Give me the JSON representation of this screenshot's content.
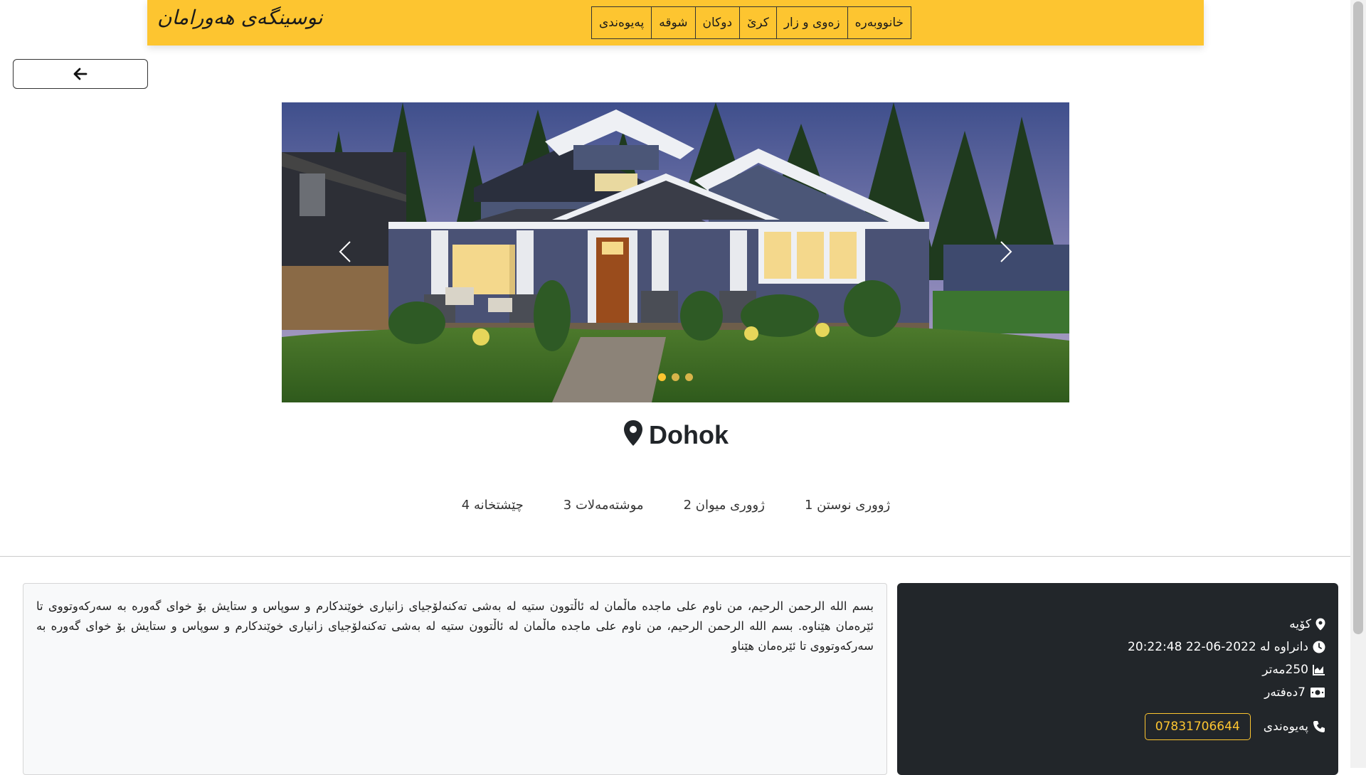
{
  "brand": {
    "name": "نوسینگەی هەورامان"
  },
  "nav": {
    "items": [
      {
        "label": "خانووبەرە"
      },
      {
        "label": "زەوی و زار"
      },
      {
        "label": "کرێ"
      },
      {
        "label": "دوکان"
      },
      {
        "label": "شوقە"
      },
      {
        "label": "پەیوەندی"
      }
    ]
  },
  "back_button": {
    "icon": "arrow-left-icon"
  },
  "carousel": {
    "slide_count": 3,
    "active_index": 0
  },
  "property": {
    "location_title": "Dohok",
    "features": [
      {
        "label": "ژووری نوستن 1"
      },
      {
        "label": "ژووری میوان 2"
      },
      {
        "label": "موشتەمەلات 3"
      },
      {
        "label": "چێشتخانە 4"
      }
    ],
    "description": "بسم الله الرحمن الرحيم، من ناوم على ماجده ماڵمان لە ئاڵتوون ستیە لە بەشی تەکنەلۆجیای زانیاری خوێندکارم و سوپاس و ستایش بۆ خوای گەورە بە سەرکەوتووی تا ئێرەمان هێناوە. بسم الله الرحمن الرحيم، من ناوم على ماجده ماڵمان لە ئاڵتوون ستیە لە بەشی تەکنەلۆجیای زانیاری خوێندکارم و سوپاس و ستایش بۆ خوای گەورە بە سەرکەوتووی تا ئێرەمان هێناو"
  },
  "info": {
    "location_label": "کۆیە",
    "posted_label": "دانراوە لە 2022-06-22 20:22:48",
    "area_label": "250مەتر",
    "deed_label": "7دەفتەر",
    "contact_label": "پەیوەندی",
    "phone": "07831706644"
  },
  "colors": {
    "accent": "#fdc530",
    "dark_card": "#22262a"
  }
}
